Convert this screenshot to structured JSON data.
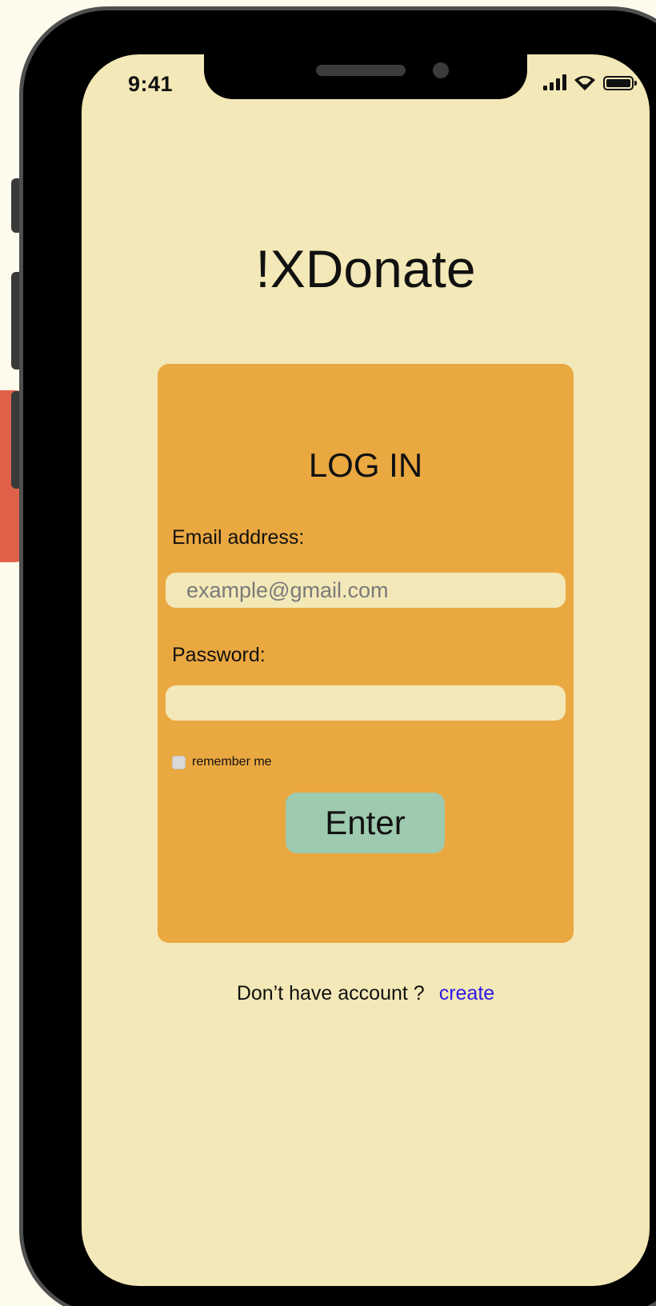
{
  "status_bar": {
    "time": "9:41",
    "icons": [
      "cellular-signal-icon",
      "wifi-icon",
      "battery-icon"
    ]
  },
  "app": {
    "title": "!XDonate"
  },
  "login_card": {
    "title": "LOG IN",
    "email_label": "Email address:",
    "email_placeholder": "example@gmail.com",
    "email_value": "",
    "password_label": "Password:",
    "password_value": "",
    "remember_label": "remember me",
    "remember_checked": false,
    "enter_label": "Enter"
  },
  "footer": {
    "prompt": "Don’t have account ?",
    "create_label": "create"
  },
  "colors": {
    "screen_background": "#f3e8b7",
    "card_background": "#eaa841",
    "button_background": "#9ecaaf",
    "link_color": "#2f18e8",
    "accent_tab": "#e0614a"
  }
}
